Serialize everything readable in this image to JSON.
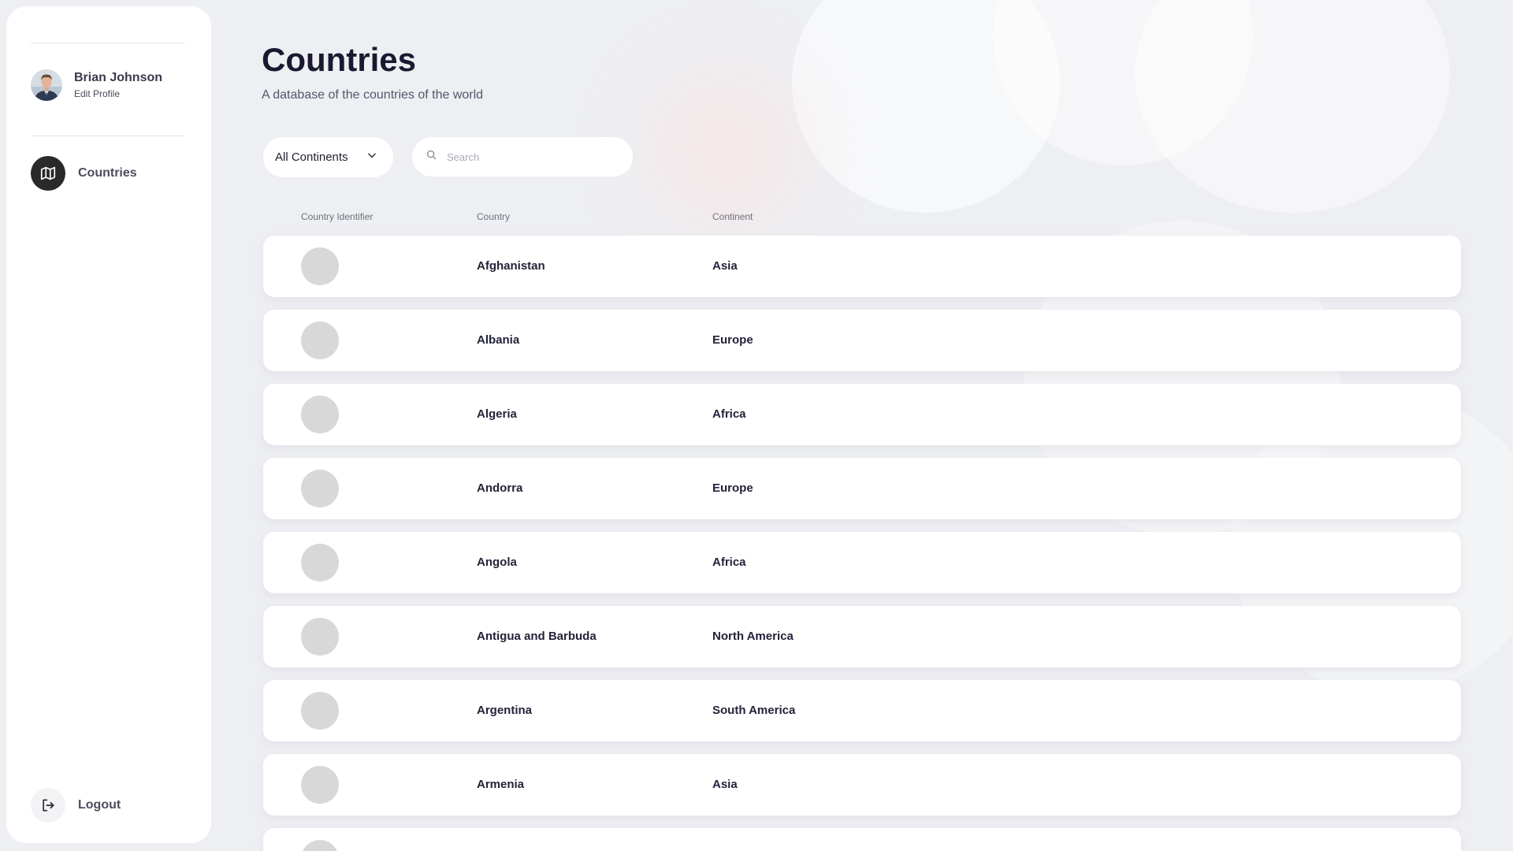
{
  "user": {
    "name": "Brian Johnson",
    "edit_profile": "Edit Profile"
  },
  "nav": {
    "countries_label": "Countries",
    "logout_label": "Logout"
  },
  "page": {
    "title": "Countries",
    "subtitle": "A database of the countries of the world"
  },
  "filters": {
    "continent_selected": "All Continents",
    "search_placeholder": "Search"
  },
  "table": {
    "columns": [
      "Country Identifier",
      "Country",
      "Continent"
    ],
    "rows": [
      {
        "country": "Afghanistan",
        "continent": "Asia"
      },
      {
        "country": "Albania",
        "continent": "Europe"
      },
      {
        "country": "Algeria",
        "continent": "Africa"
      },
      {
        "country": "Andorra",
        "continent": "Europe"
      },
      {
        "country": "Angola",
        "continent": "Africa"
      },
      {
        "country": "Antigua and Barbuda",
        "continent": "North America"
      },
      {
        "country": "Argentina",
        "continent": "South America"
      },
      {
        "country": "Armenia",
        "continent": "Asia"
      },
      {
        "country": "",
        "continent": ""
      }
    ]
  },
  "colors": {
    "background": "#eeeff3",
    "active_nav": "#2a2a2c",
    "text_dark": "#1a1930"
  }
}
